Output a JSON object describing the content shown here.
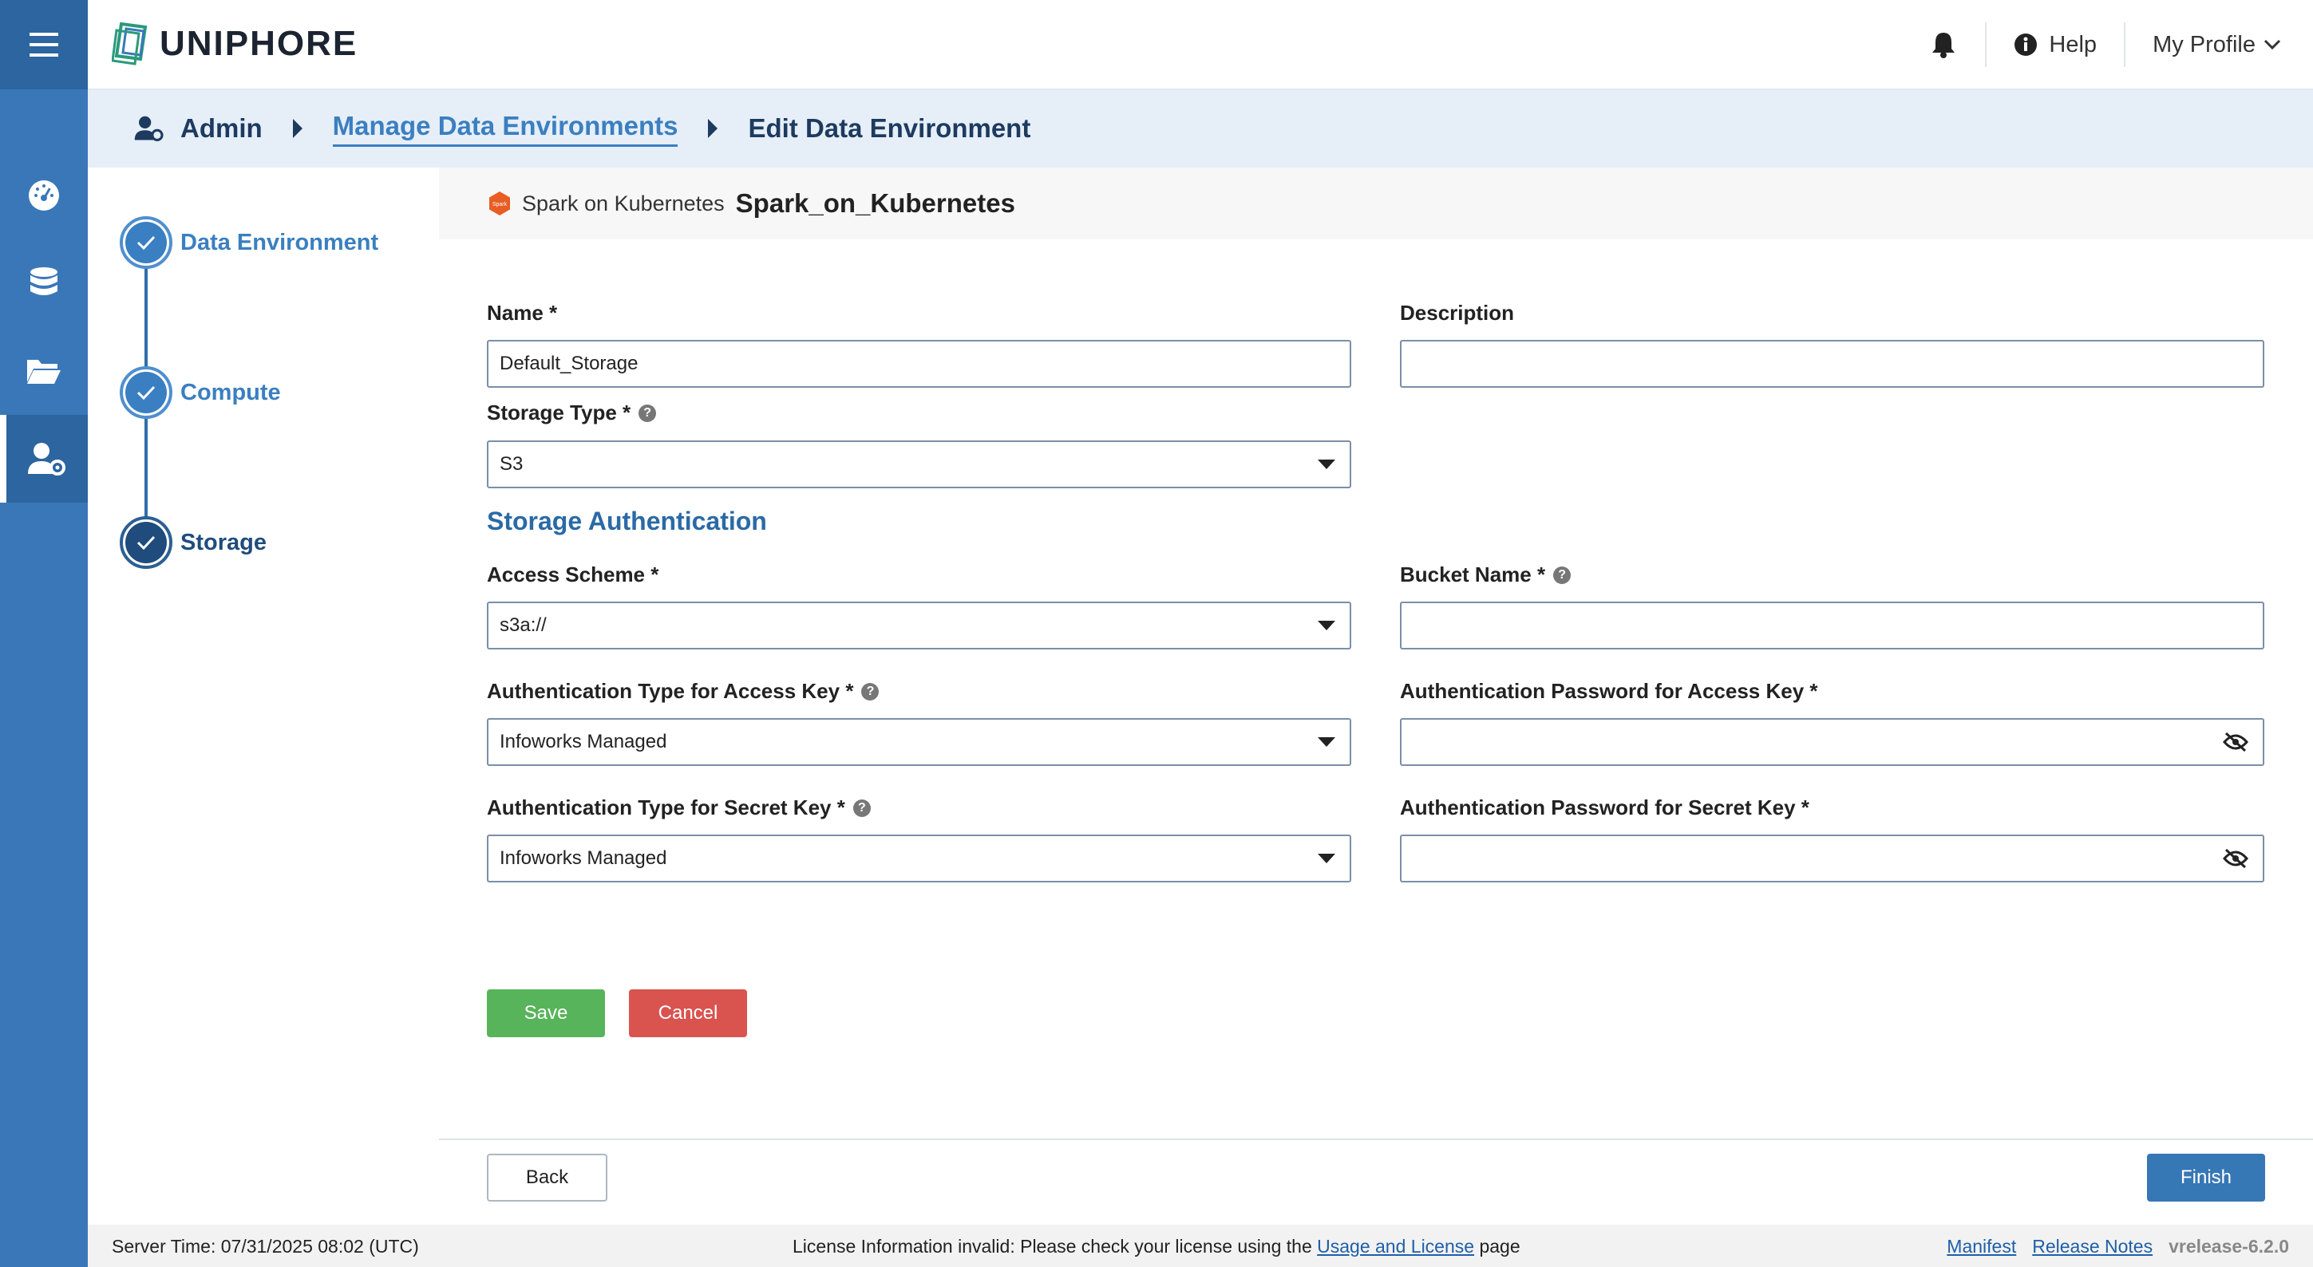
{
  "brand": {
    "name": "UNIPHORE"
  },
  "header": {
    "help_label": "Help",
    "profile_label": "My Profile"
  },
  "breadcrumb": {
    "items": [
      {
        "label": "Admin"
      },
      {
        "label": "Manage Data Environments"
      },
      {
        "label": "Edit Data Environment"
      }
    ]
  },
  "steps": [
    {
      "label": "Data Environment",
      "state": "complete"
    },
    {
      "label": "Compute",
      "state": "complete"
    },
    {
      "label": "Storage",
      "state": "current"
    }
  ],
  "environment": {
    "type_label": "Spark on Kubernetes",
    "name": "Spark_on_Kubernetes"
  },
  "form": {
    "name_label": "Name *",
    "name_value": "Default_Storage",
    "description_label": "Description",
    "description_value": "",
    "storage_type_label": "Storage Type *",
    "storage_type_value": "S3",
    "section_title": "Storage Authentication",
    "access_scheme_label": "Access Scheme *",
    "access_scheme_value": "s3a://",
    "bucket_name_label": "Bucket Name *",
    "bucket_name_value": "",
    "auth_type_access_label": "Authentication Type for Access Key *",
    "auth_type_access_value": "Infoworks Managed",
    "auth_pwd_access_label": "Authentication Password for Access Key *",
    "auth_pwd_access_value": "",
    "auth_type_secret_label": "Authentication Type for Secret Key *",
    "auth_type_secret_value": "Infoworks Managed",
    "auth_pwd_secret_label": "Authentication Password for Secret Key *",
    "auth_pwd_secret_value": ""
  },
  "buttons": {
    "save": "Save",
    "cancel": "Cancel",
    "back": "Back",
    "finish": "Finish"
  },
  "footer": {
    "server_time": "Server Time: 07/31/2025 08:02 (UTC)",
    "license_prefix": "License Information invalid: Please check your license using the",
    "license_link": "Usage and License",
    "license_suffix": "page",
    "manifest": "Manifest",
    "release_notes": "Release Notes",
    "version": "vrelease-6.2.0"
  },
  "colors": {
    "rail": "#3a77b9",
    "primary": "#3a7fc1",
    "save": "#58b45a",
    "cancel": "#d9534f",
    "finish": "#3677b5"
  },
  "icons": [
    "menu-icon",
    "dashboard-icon",
    "database-icon",
    "folder-icon",
    "user-settings-icon",
    "bell-icon",
    "info-icon",
    "chevron-down-icon",
    "check-icon",
    "eye-slash-icon",
    "help-icon",
    "spark-icon"
  ]
}
